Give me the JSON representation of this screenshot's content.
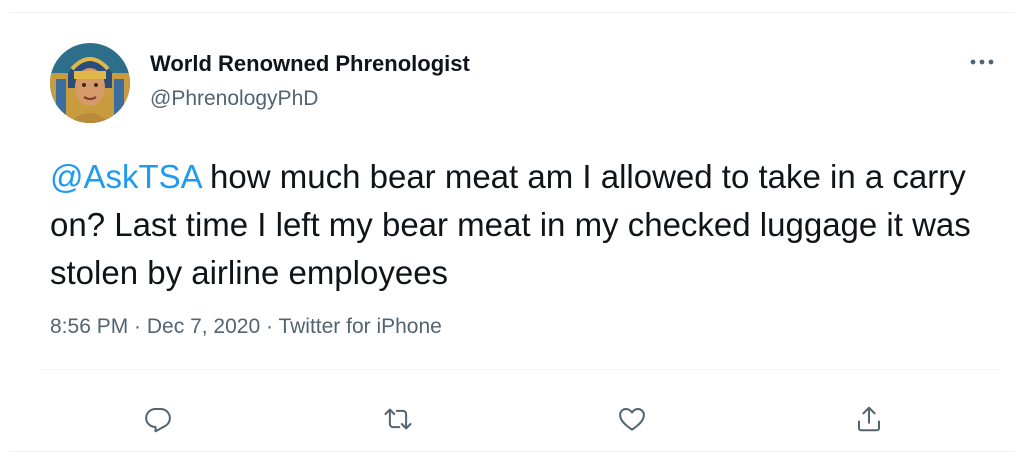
{
  "tweet": {
    "display_name": "World Renowned Phrenologist",
    "handle": "@PhrenologyPhD",
    "mention": "@AskTSA",
    "body": " how much bear meat am I allowed to take in a carry on? Last time I left my bear meat in my checked luggage it was stolen by airline employees",
    "time": "8:56 PM",
    "separator": " · ",
    "date": "Dec 7, 2020",
    "source": "Twitter for iPhone"
  },
  "actions": {
    "reply_icon": "reply-icon",
    "retweet_icon": "retweet-icon",
    "like_icon": "heart-icon",
    "share_icon": "share-icon",
    "more_icon": "more-icon"
  },
  "colors": {
    "link": "#1d9bf0",
    "text": "#0f1419",
    "secondary": "#536471",
    "divider": "#eff3f4"
  }
}
